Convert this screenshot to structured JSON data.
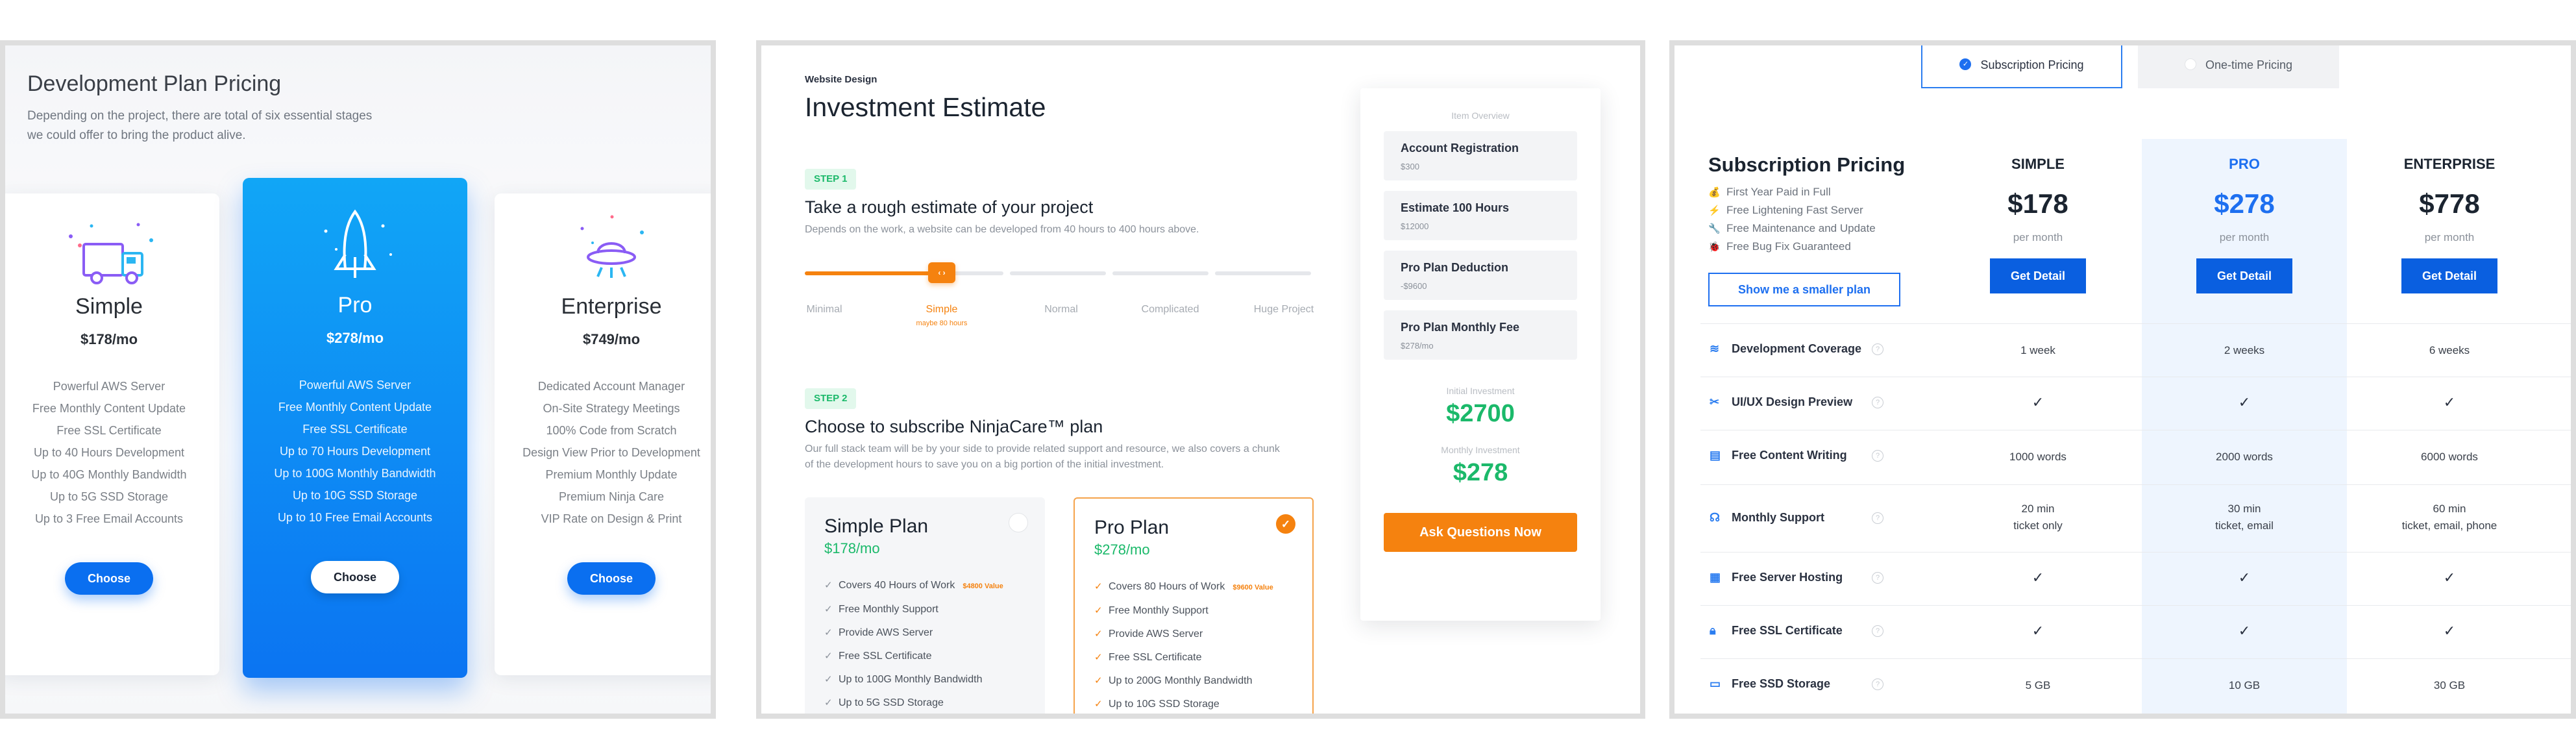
{
  "panel1": {
    "title": "Development Plan Pricing",
    "description": "Depending on the project, there are total of six essential stages we could offer to bring the product alive.",
    "plans": [
      {
        "name": "Simple",
        "price": "$178/mo",
        "icon": "truck-icon",
        "button": "Choose",
        "features": [
          "Powerful AWS Server",
          "Free Monthly Content Update",
          "Free SSL Certificate",
          "Up to 40 Hours Development",
          "Up to 40G Monthly Bandwidth",
          "Up to 5G SSD Storage",
          "Up to 3 Free Email Accounts"
        ]
      },
      {
        "name": "Pro",
        "price": "$278/mo",
        "icon": "rocket-icon",
        "button": "Choose",
        "features": [
          "Powerful AWS Server",
          "Free Monthly Content Update",
          "Free SSL Certificate",
          "Up to 70 Hours Development",
          "Up to 100G Monthly Bandwidth",
          "Up to 10G SSD Storage",
          "Up to 10 Free Email Accounts"
        ]
      },
      {
        "name": "Enterprise",
        "price": "$749/mo",
        "icon": "ufo-icon",
        "button": "Choose",
        "features": [
          "Dedicated Account Manager",
          "On-Site Strategy Meetings",
          "100% Code from Scratch",
          "Design View Prior to Development",
          "Premium Monthly Update",
          "Premium Ninja Care",
          "VIP Rate on Design & Print"
        ]
      }
    ],
    "accent": "#0a6ff0"
  },
  "panel2": {
    "eyebrow": "Website Design",
    "title": "Investment Estimate",
    "step1": {
      "badge": "STEP 1",
      "title": "Take a rough estimate of your project",
      "desc": "Depends on the work, a website can be developed from 40 hours to 400 hours above.",
      "handle": "‹ ›",
      "value_fraction": 0.27,
      "labels": [
        "Minimal",
        "Simple",
        "Normal",
        "Complicated",
        "Huge Project"
      ],
      "sub_label": "maybe 80 hours"
    },
    "step2": {
      "badge": "STEP 2",
      "title": "Choose to subscribe NinjaCare™ plan",
      "desc": "Our full stack team will be by your side to provide related support and resource, we also covers a chunk of the development hours to save you on a big portion of the initial investment."
    },
    "plans": [
      {
        "name": "Simple Plan",
        "price": "$178/mo",
        "selected": false,
        "features": [
          {
            "text": "Covers 40 Hours of Work",
            "value": "$4800 Value"
          },
          {
            "text": "Free Monthly Support"
          },
          {
            "text": "Provide AWS Server"
          },
          {
            "text": "Free SSL Certificate"
          },
          {
            "text": "Up to 100G Monthly Bandwidth"
          },
          {
            "text": "Up to 5G SSD Storage"
          }
        ]
      },
      {
        "name": "Pro Plan",
        "price": "$278/mo",
        "selected": true,
        "features": [
          {
            "text": "Covers 80 Hours of Work",
            "value": "$9600 Value"
          },
          {
            "text": "Free Monthly Support"
          },
          {
            "text": "Provide AWS Server"
          },
          {
            "text": "Free SSL Certificate"
          },
          {
            "text": "Up to 200G Monthly Bandwidth"
          },
          {
            "text": "Up to 10G SSD Storage"
          }
        ]
      }
    ],
    "overview": {
      "heading": "Item Overview",
      "items": [
        {
          "title": "Account Registration",
          "value": "$300"
        },
        {
          "title": "Estimate 100 Hours",
          "value": "$12000"
        },
        {
          "title": "Pro Plan Deduction",
          "value": "-$9600"
        },
        {
          "title": "Pro Plan Monthly Fee",
          "value": "$278/mo"
        }
      ],
      "initial_label": "Initial Investment",
      "initial_value": "$2700",
      "monthly_label": "Monthly Investment",
      "monthly_value": "$278",
      "cta": "Ask Questions Now"
    },
    "colors": {
      "orange": "#f5820f",
      "green": "#1bb96a"
    }
  },
  "panel3": {
    "tabs": [
      {
        "label": "Subscription Pricing",
        "active": true
      },
      {
        "label": "One-time Pricing",
        "active": false
      }
    ],
    "title": "Subscription Pricing",
    "perks": [
      {
        "icon": "money-bag-icon",
        "text": "First Year Paid in Full"
      },
      {
        "icon": "lightning-icon",
        "text": "Free Lightening Fast Server"
      },
      {
        "icon": "wrench-icon",
        "text": "Free Maintenance and Update"
      },
      {
        "icon": "bug-icon",
        "text": "Free Bug Fix Guaranteed"
      }
    ],
    "smaller_plan": "Show me a smaller plan",
    "columns": [
      {
        "name": "SIMPLE",
        "price": "$178",
        "per": "per month",
        "button": "Get Detail"
      },
      {
        "name": "PRO",
        "price": "$278",
        "per": "per month",
        "button": "Get Detail"
      },
      {
        "name": "ENTERPRISE",
        "price": "$778",
        "per": "per month",
        "button": "Get Detail"
      }
    ],
    "rows": [
      {
        "name": "Development Coverage",
        "icon": "layers-icon",
        "values": [
          "1 week",
          "2 weeks",
          "6 weeks"
        ]
      },
      {
        "name": "UI/UX Design Preview",
        "icon": "design-tools-icon",
        "values": [
          "✓",
          "✓",
          "✓"
        ]
      },
      {
        "name": "Free Content Writing",
        "icon": "document-icon",
        "values": [
          "1000 words",
          "2000 words",
          "6000 words"
        ]
      },
      {
        "name": "Monthly Support",
        "icon": "headset-icon",
        "values": [
          "20 min\nticket only",
          "30 min\nticket, email",
          "60 min\nticket, email, phone"
        ]
      },
      {
        "name": "Free Server Hosting",
        "icon": "server-icon",
        "values": [
          "✓",
          "✓",
          "✓"
        ]
      },
      {
        "name": "Free SSL Certificate",
        "icon": "lock-icon",
        "values": [
          "✓",
          "✓",
          "✓"
        ]
      },
      {
        "name": "Free SSD Storage",
        "icon": "drive-icon",
        "values": [
          "5 GB",
          "10 GB",
          "30 GB"
        ]
      }
    ],
    "accent": "#1d6ff0"
  }
}
